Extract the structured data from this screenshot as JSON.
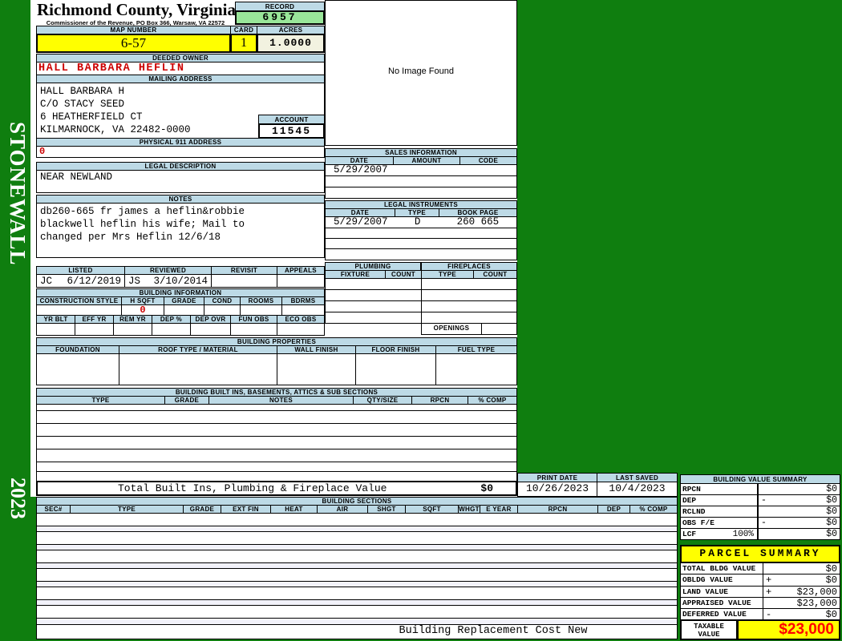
{
  "colors": {
    "background_green": "#0F7E0F",
    "band_blue": "#BDDAE6",
    "highlight_yellow": "#FFFF00",
    "record_green": "#99E699",
    "acres_cream": "#F2F2E0",
    "alert_red": "#CC0000",
    "taxable_red": "#FF0000"
  },
  "sidebar": {
    "district": "STONEWALL",
    "year": "2023"
  },
  "header": {
    "county": "Richmond County, Virginia",
    "office_line": "Commissioner of the Revenue, PO Box 366, Warsaw, VA 22572",
    "record": {
      "label": "RECORD",
      "value": "6957"
    },
    "map_number": {
      "label": "MAP NUMBER",
      "value": "6-57"
    },
    "card": {
      "label": "CARD",
      "value": "1"
    },
    "acres": {
      "label": "ACRES",
      "value": "1.0000"
    }
  },
  "owner": {
    "deeded_owner": {
      "label": "DEEDED OWNER",
      "value": "HALL BARBARA HEFLIN"
    },
    "mailing_address": {
      "label": "MAILING ADDRESS",
      "lines": [
        "HALL BARBARA H",
        "C/O STACY SEED",
        "6 HEATHERFIELD CT",
        "KILMARNOCK, VA 22482-0000"
      ]
    },
    "account": {
      "label": "ACCOUNT",
      "value": "11545"
    },
    "physical_911_address": {
      "label": "PHYSICAL 911 ADDRESS",
      "value": "0"
    },
    "legal_description": {
      "label": "LEGAL DESCRIPTION",
      "value": "NEAR NEWLAND"
    },
    "notes": {
      "label": "NOTES",
      "lines": [
        "db260-665 fr james a heflin&robbie",
        "blackwell heflin his wife; Mail to",
        "changed per Mrs Heflin 12/6/18"
      ]
    }
  },
  "review": {
    "listed": {
      "label": "LISTED",
      "by": "JC",
      "date": "6/12/2019"
    },
    "reviewed": {
      "label": "REVIEWED",
      "by": "JS",
      "date": "3/10/2014"
    },
    "revisit": {
      "label": "REVISIT"
    },
    "appeals": {
      "label": "APPEALS"
    }
  },
  "image_panel": {
    "placeholder": "No Image Found"
  },
  "sales_information": {
    "title": "SALES INFORMATION",
    "headers": [
      "DATE",
      "AMOUNT",
      "CODE"
    ],
    "rows": [
      {
        "date": "5/29/2007",
        "amount": "",
        "code": ""
      }
    ]
  },
  "legal_instruments": {
    "title": "LEGAL INSTRUMENTS",
    "headers": [
      "DATE",
      "TYPE",
      "BOOK PAGE"
    ],
    "rows": [
      {
        "date": "5/29/2007",
        "type": "D",
        "book_page": "260 665"
      }
    ]
  },
  "plumbing": {
    "title": "PLUMBING",
    "headers": [
      "FIXTURE",
      "COUNT"
    ]
  },
  "fireplaces": {
    "title": "FIREPLACES",
    "headers": [
      "TYPE",
      "COUNT"
    ],
    "openings_label": "OPENINGS",
    "openings_value": ""
  },
  "building_information": {
    "title": "BUILDING INFORMATION",
    "row1_headers": [
      "CONSTRUCTION STYLE",
      "H SQFT",
      "GRADE",
      "COND",
      "ROOMS",
      "BDRMS"
    ],
    "h_sqft": "0",
    "row2_headers": [
      "YR BLT",
      "EFF YR",
      "REM YR",
      "DEP %",
      "DEP OVR",
      "FUN OBS",
      "ECO OBS"
    ]
  },
  "building_properties": {
    "title": "BUILDING PROPERTIES",
    "headers": [
      "FOUNDATION",
      "ROOF TYPE / MATERIAL",
      "WALL FINISH",
      "FLOOR FINISH",
      "FUEL TYPE"
    ]
  },
  "built_ins": {
    "title": "BUILDING BUILT INS, BASEMENTS, ATTICS & SUB SECTIONS",
    "headers": [
      "TYPE",
      "GRADE",
      "NOTES",
      "QTY/SIZE",
      "RPCN",
      "% COMP"
    ],
    "total_label": "Total Built Ins, Plumbing & Fireplace Value",
    "total_value": "$0"
  },
  "print_info": {
    "print_date": {
      "label": "PRINT DATE",
      "value": "10/26/2023"
    },
    "last_saved": {
      "label": "LAST SAVED",
      "value": "10/4/2023"
    }
  },
  "building_sections": {
    "title": "BUILDING SECTIONS",
    "headers": [
      "SEC#",
      "TYPE",
      "GRADE",
      "EXT FIN",
      "HEAT",
      "AIR",
      "SHGT",
      "SQFT",
      "WHGT",
      "E YEAR",
      "RPCN",
      "DEP",
      "% COMP"
    ],
    "footer_label": "Building Replacement Cost New"
  },
  "building_value_summary": {
    "title": "BUILDING VALUE SUMMARY",
    "rows": [
      {
        "label": "RPCN",
        "op": "",
        "value": "$0"
      },
      {
        "label": "DEP",
        "op": "-",
        "value": "$0"
      },
      {
        "label": "RCLND",
        "op": "",
        "value": "$0"
      },
      {
        "label": "OBS F/E",
        "op": "-",
        "value": "$0"
      },
      {
        "label": "LCF",
        "percent": "100%",
        "op": "",
        "value": "$0"
      }
    ]
  },
  "parcel_summary": {
    "title": "PARCEL SUMMARY",
    "rows": [
      {
        "label": "TOTAL BLDG VALUE",
        "op": "",
        "value": "$0"
      },
      {
        "label": "OBLDG VALUE",
        "op": "+",
        "value": "$0"
      },
      {
        "label": "LAND VALUE",
        "op": "+",
        "value": "$23,000"
      },
      {
        "label": "APPRAISED VALUE",
        "op": "",
        "value": "$23,000"
      },
      {
        "label": "DEFERRED VALUE",
        "op": "-",
        "value": "$0"
      }
    ],
    "taxable": {
      "label_lines": [
        "TAXABLE",
        "VALUE"
      ],
      "value": "$23,000"
    }
  }
}
